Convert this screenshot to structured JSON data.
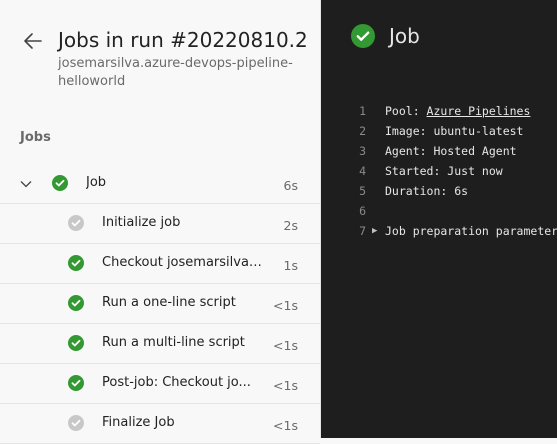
{
  "header": {
    "title": "Jobs in run #20220810.2",
    "subtitle": "josemarsilva.azure-devops-pipeline-helloworld"
  },
  "jobs_section": {
    "label": "Jobs",
    "job": {
      "name": "Job",
      "duration": "6s"
    },
    "steps": [
      {
        "name": "Initialize job",
        "duration": "2s",
        "status": "skipped"
      },
      {
        "name": "Checkout josemarsilva/...",
        "duration": "1s",
        "status": "success"
      },
      {
        "name": "Run a one-line script",
        "duration": "<1s",
        "status": "success"
      },
      {
        "name": "Run a multi-line script",
        "duration": "<1s",
        "status": "success"
      },
      {
        "name": "Post-job: Checkout jo...",
        "duration": "<1s",
        "status": "success"
      },
      {
        "name": "Finalize Job",
        "duration": "<1s",
        "status": "skipped"
      }
    ]
  },
  "detail": {
    "title": "Job",
    "log": [
      {
        "n": "1",
        "prefix": "Pool: ",
        "link": "Azure Pipelines"
      },
      {
        "n": "2",
        "text": "Image: ubuntu-latest"
      },
      {
        "n": "3",
        "text": "Agent: Hosted Agent"
      },
      {
        "n": "4",
        "text": "Started: Just now"
      },
      {
        "n": "5",
        "text": "Duration: 6s"
      },
      {
        "n": "6",
        "text": ""
      },
      {
        "n": "7",
        "text": "Job preparation parameters"
      }
    ]
  },
  "colors": {
    "success": "#339933",
    "skipped": "#c8c8c8",
    "log_bg": "#1e1e1e"
  },
  "icons": {
    "back": "arrow-left-icon",
    "expand": "chevron-down-icon",
    "success": "check-circle-icon",
    "expander": "triangle-right-icon"
  }
}
